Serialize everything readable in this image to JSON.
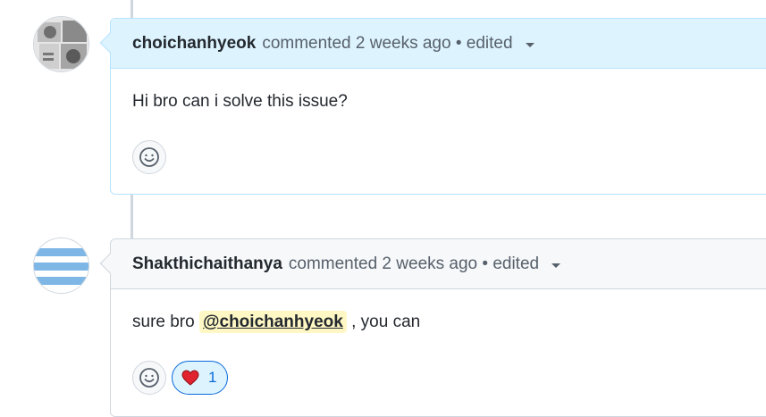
{
  "comments": [
    {
      "author": "choichanhyeok",
      "meta": "commented 2 weeks ago • edited",
      "body": "Hi bro can i solve this issue?"
    },
    {
      "author": "Shakthichaithanya",
      "meta": "commented 2 weeks ago • edited",
      "body_prefix": "sure bro ",
      "mention": "@choichanhyeok",
      "body_suffix": " , you can",
      "reaction": {
        "icon": "heart-icon",
        "count": "1"
      }
    }
  ],
  "colors": {
    "highlight_header": "#ddf4ff",
    "default_header": "#f6f8fa",
    "mention_bg": "#fff8c5",
    "heart": "#cf222e"
  }
}
